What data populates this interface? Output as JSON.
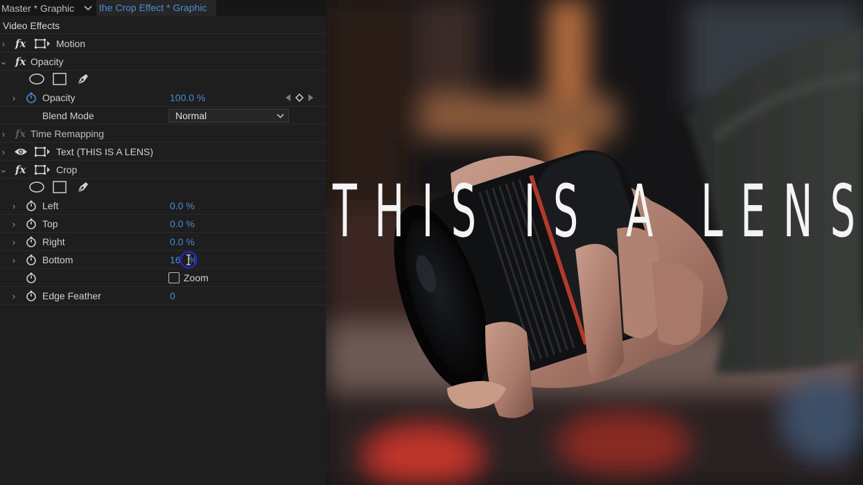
{
  "tabs": {
    "master": "Master * Graphic",
    "active": "the Crop Effect * Graphic"
  },
  "section_title": "Video Effects",
  "effects": {
    "motion": {
      "label": "Motion"
    },
    "opacity": {
      "label": "Opacity",
      "opacity_label": "Opacity",
      "opacity_value": "100.0 %",
      "blend_label": "Blend Mode",
      "blend_value": "Normal"
    },
    "time_remapping": {
      "label": "Time Remapping"
    },
    "text": {
      "label": "Text (THIS IS A LENS)"
    },
    "crop": {
      "label": "Crop",
      "left_label": "Left",
      "left_value": "0.0 %",
      "top_label": "Top",
      "top_value": "0.0 %",
      "right_label": "Right",
      "right_value": "0.0 %",
      "bottom_label": "Bottom",
      "bottom_value": "16",
      "bottom_unit": "%",
      "zoom_label": "Zoom",
      "feather_label": "Edge Feather",
      "feather_value": "0"
    }
  },
  "monitor": {
    "overlay_text": "THIS IS A LENS"
  },
  "colors": {
    "value_blue": "#4d8ad6",
    "panel_bg": "#1e1e1e",
    "cursor_ring": "#2424c8"
  }
}
